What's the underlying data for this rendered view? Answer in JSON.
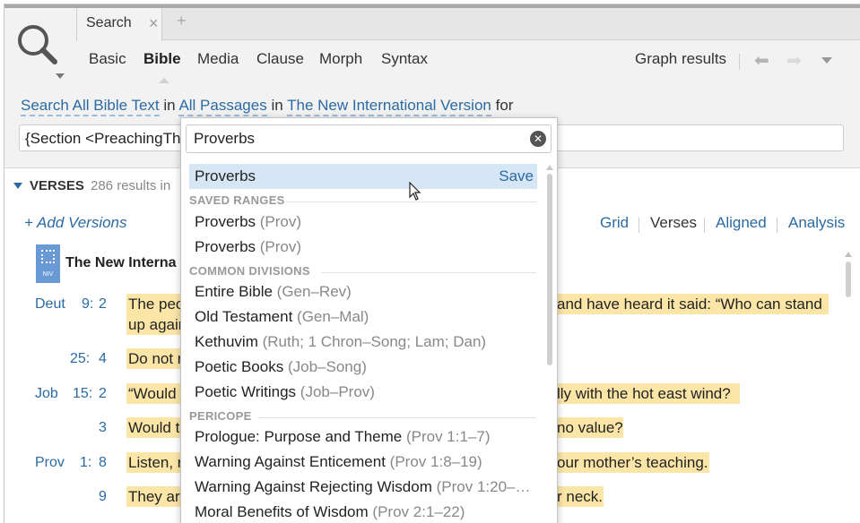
{
  "tab": {
    "label": "Search",
    "close_glyph": "×",
    "add_glyph": "+"
  },
  "search_modes": [
    "Basic",
    "Bible",
    "Media",
    "Clause",
    "Morph",
    "Syntax"
  ],
  "active_mode": "Bible",
  "toolbar": {
    "graph_results": "Graph results",
    "back_icon": "arrow-left-icon",
    "forward_icon": "arrow-right-icon",
    "menu_icon": "chevron-down-icon"
  },
  "query": {
    "scope": "Search All Bible Text",
    "in1": "in",
    "passages": "All Passages",
    "in2": "in",
    "version": "The New International Version",
    "for": "for",
    "text": "{Section <PreachingTh"
  },
  "results": {
    "section_title": "VERSES",
    "count_text": "286 results in",
    "add_versions": "+ Add Versions",
    "views": [
      "Grid",
      "Verses",
      "Aligned",
      "Analysis"
    ],
    "current_view": "Verses",
    "version_name": "The New Interna",
    "version_badge": "NIV",
    "verses": [
      {
        "book": "Deut",
        "chapter": "9:",
        "verse": "2",
        "text_left": "The peo",
        "text_right": "and have heard it said: “Who can stand",
        "line2": "up again"
      },
      {
        "book": "",
        "chapter": "25:",
        "verse": "4",
        "text_left": "Do not r",
        "text_right": ""
      },
      {
        "book": "Job",
        "chapter": "15:",
        "verse": "2",
        "text_left": "“Would",
        "text_right": "lly with the hot east wind?"
      },
      {
        "book": "",
        "chapter": "",
        "verse": "3",
        "text_left": "Would t",
        "text_right": "no value?"
      },
      {
        "book": "Prov",
        "chapter": "1:",
        "verse": "8",
        "text_left": "Listen, r",
        "text_right": "our mother’s teaching."
      },
      {
        "book": "",
        "chapter": "",
        "verse": "9",
        "text_left": "They are",
        "text_right": "r neck."
      }
    ]
  },
  "dropdown": {
    "input_value": "Proverbs",
    "clear_icon": "clear-circle-icon",
    "top_item": {
      "label": "Proverbs",
      "action": "Save"
    },
    "sections": [
      {
        "title": "SAVED RANGES",
        "items": [
          {
            "label": "Proverbs",
            "abbr": "(Prov)"
          },
          {
            "label": "Proverbs",
            "abbr": "(Prov)"
          }
        ]
      },
      {
        "title": "COMMON DIVISIONS",
        "items": [
          {
            "label": "Entire Bible",
            "abbr": "(Gen–Rev)"
          },
          {
            "label": "Old Testament",
            "abbr": "(Gen–Mal)"
          },
          {
            "label": "Kethuvim",
            "abbr": "(Ruth; 1 Chron–Song; Lam; Dan)"
          },
          {
            "label": "Poetic Books",
            "abbr": "(Job–Song)"
          },
          {
            "label": "Poetic Writings",
            "abbr": "(Job–Prov)"
          }
        ]
      },
      {
        "title": "PERICOPE",
        "items": [
          {
            "label": "Prologue: Purpose and Theme",
            "abbr": "(Prov 1:1–7)"
          },
          {
            "label": "Warning Against Enticement",
            "abbr": "(Prov 1:8–19)"
          },
          {
            "label": "Warning Against Rejecting Wisdom",
            "abbr": "(Prov 1:20–…"
          },
          {
            "label": "Moral Benefits of Wisdom",
            "abbr": "(Prov 2:1–22)"
          }
        ]
      }
    ]
  },
  "colors": {
    "link": "#2b6aa3",
    "highlight": "#fbe6a8",
    "selected_row": "#d7e6f5"
  }
}
